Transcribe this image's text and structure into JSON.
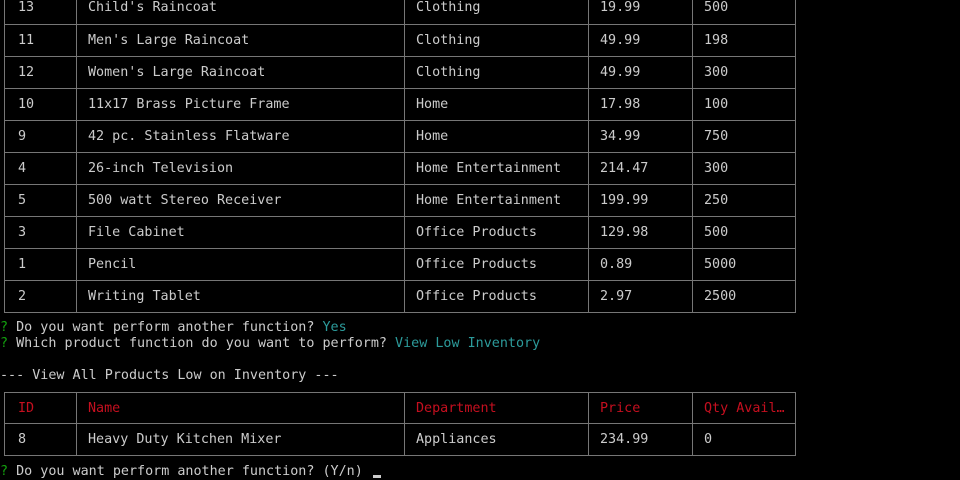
{
  "products_table": {
    "rows": [
      {
        "id": "13",
        "name": "Child's Raincoat",
        "department": "Clothing",
        "price": "19.99",
        "qty": "500"
      },
      {
        "id": "11",
        "name": "Men's Large Raincoat",
        "department": "Clothing",
        "price": "49.99",
        "qty": "198"
      },
      {
        "id": "12",
        "name": "Women's Large Raincoat",
        "department": "Clothing",
        "price": "49.99",
        "qty": "300"
      },
      {
        "id": "10",
        "name": "11x17 Brass Picture Frame",
        "department": "Home",
        "price": "17.98",
        "qty": "100"
      },
      {
        "id": "9",
        "name": "42 pc. Stainless Flatware",
        "department": "Home",
        "price": "34.99",
        "qty": "750"
      },
      {
        "id": "4",
        "name": "26-inch Television",
        "department": "Home Entertainment",
        "price": "214.47",
        "qty": "300"
      },
      {
        "id": "5",
        "name": "500 watt Stereo Receiver",
        "department": "Home Entertainment",
        "price": "199.99",
        "qty": "250"
      },
      {
        "id": "3",
        "name": "File Cabinet",
        "department": "Office Products",
        "price": "129.98",
        "qty": "500"
      },
      {
        "id": "1",
        "name": "Pencil",
        "department": "Office Products",
        "price": "0.89",
        "qty": "5000"
      },
      {
        "id": "2",
        "name": "Writing Tablet",
        "department": "Office Products",
        "price": "2.97",
        "qty": "2500"
      }
    ]
  },
  "prompts": {
    "marker": "?",
    "another_function_question": "Do you want perform another function?",
    "another_function_answer": "Yes",
    "which_function_question": "Which product function do you want to perform?",
    "which_function_answer": "View Low Inventory",
    "section_heading": "--- View All Products Low on Inventory ---",
    "final_question": "Do you want perform another function?",
    "final_hint": "(Y/n)"
  },
  "low_inventory_table": {
    "headers": {
      "id": "ID",
      "name": "Name",
      "department": "Department",
      "price": "Price",
      "qty": "Qty Avail…"
    },
    "rows": [
      {
        "id": "8",
        "name": "Heavy Duty Kitchen Mixer",
        "department": "Appliances",
        "price": "234.99",
        "qty": "0"
      }
    ]
  },
  "colors": {
    "background": "#000000",
    "text": "#cccccc",
    "prompt_marker": "#13a10e",
    "answer": "#2c9b9b",
    "header_text": "#c50f1f",
    "border": "#767676"
  }
}
